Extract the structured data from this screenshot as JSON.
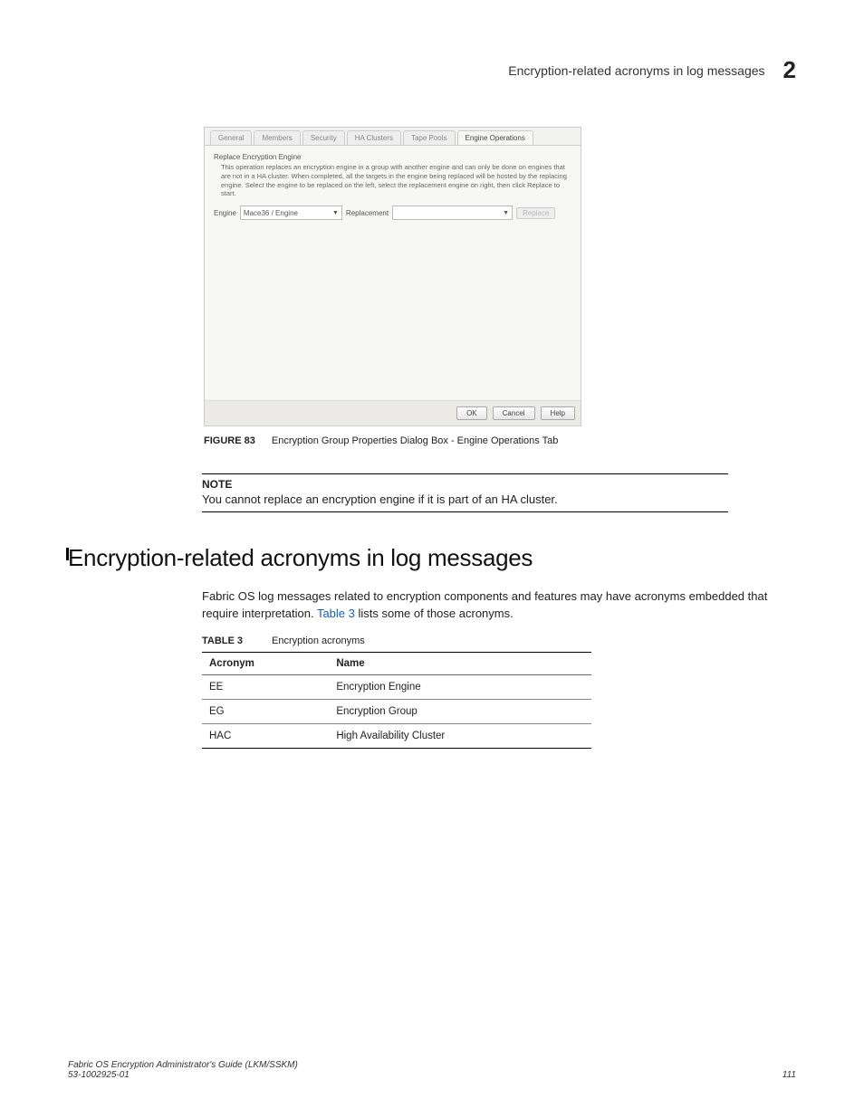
{
  "header": {
    "title": "Encryption-related acronyms in log messages",
    "chapter": "2"
  },
  "screenshot": {
    "tabs": [
      "General",
      "Members",
      "Security",
      "HA Clusters",
      "Tape Pools",
      "Engine Operations"
    ],
    "active_tab_index": 5,
    "panel_title": "Replace Encryption Engine",
    "panel_desc": "This operation replaces an encryption engine in a group with another engine and can only be done on engines that are not in a HA cluster. When completed, all the targets in the engine being replaced will be hosted by the replacing engine. Select the engine to be replaced on the left, select the replacement engine on right, then click Replace to start.",
    "engine_label": "Engine",
    "engine_value": "Mace36 / Engine",
    "replacement_label": "Replacement",
    "replacement_value": "",
    "replace_button": "Replace",
    "buttons": {
      "ok": "OK",
      "cancel": "Cancel",
      "help": "Help"
    }
  },
  "figure": {
    "label": "FIGURE 83",
    "caption": "Encryption Group Properties Dialog Box - Engine Operations Tab"
  },
  "note": {
    "label": "NOTE",
    "text": "You cannot replace an encryption engine if it is part of an HA cluster."
  },
  "section_heading": "Encryption-related acronyms in log messages",
  "body_text_1": "Fabric OS log messages related to encryption components and features may have acronyms embedded that require interpretation. ",
  "body_link": "Table 3",
  "body_text_2": " lists some of those acronyms.",
  "table": {
    "label": "TABLE 3",
    "caption": "Encryption acronyms",
    "headers": {
      "col1": "Acronym",
      "col2": "Name"
    },
    "rows": [
      {
        "acronym": "EE",
        "name": "Encryption Engine"
      },
      {
        "acronym": "EG",
        "name": "Encryption Group"
      },
      {
        "acronym": "HAC",
        "name": "High Availability Cluster"
      }
    ]
  },
  "footer": {
    "left_line1": "Fabric OS Encryption Administrator's Guide  (LKM/SSKM)",
    "left_line2": "53-1002925-01",
    "page": "111"
  }
}
